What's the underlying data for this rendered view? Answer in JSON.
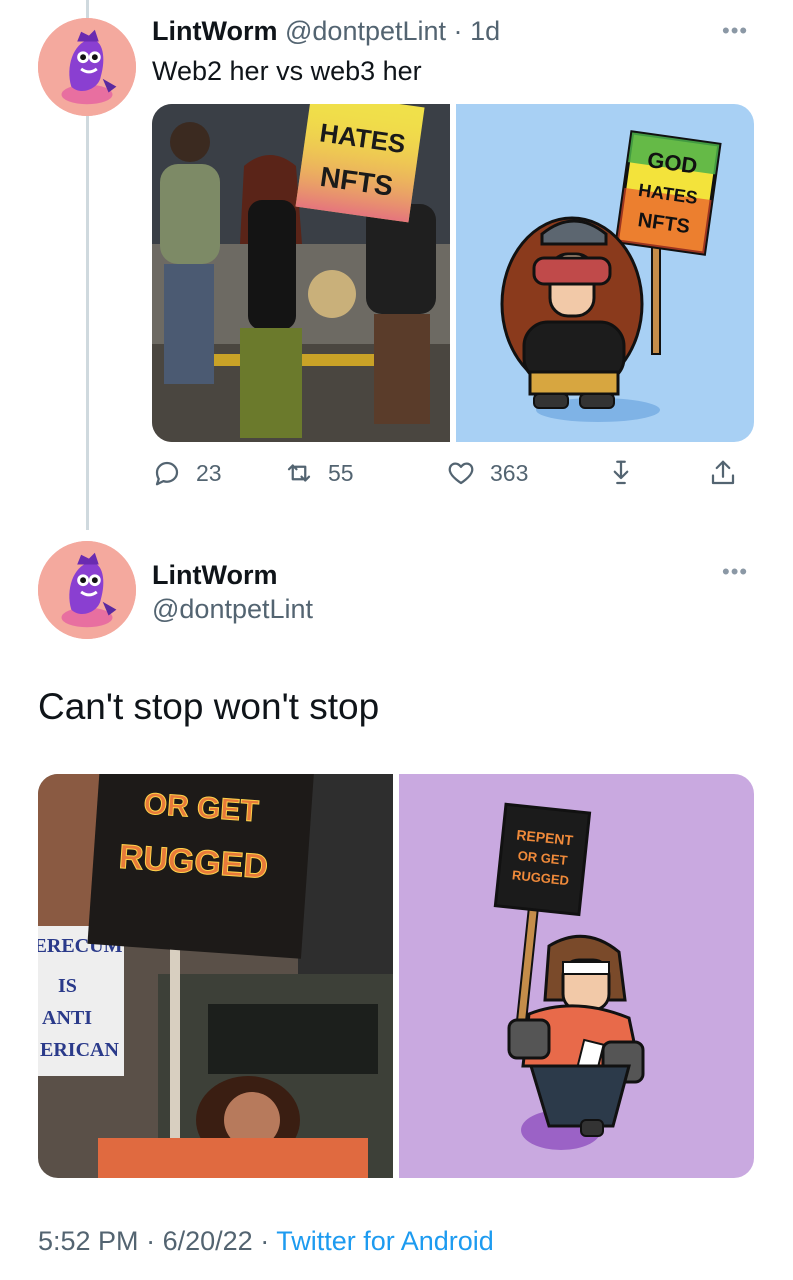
{
  "tweet1": {
    "author_name": "LintWorm",
    "author_handle": "@dontpetLint",
    "separator": "·",
    "time_ago": "1d",
    "text": "Web2 her vs web3 her",
    "photo_left_sign": [
      "HATES",
      "NFTS"
    ],
    "photo_right_sign": [
      "GOD",
      "HATES",
      "NFTS"
    ],
    "actions": {
      "replies": "23",
      "retweets": "55",
      "likes": "363"
    }
  },
  "tweet2": {
    "author_name": "LintWorm",
    "author_handle": "@dontpetLint",
    "text": "Can't stop won't stop",
    "photo_left_sign": [
      "OR GET",
      "RUGGED"
    ],
    "photo_left_side_sign": [
      "ERECUM",
      "IS",
      "ANTI",
      "ERICAN"
    ],
    "photo_right_sign": [
      "REPENT",
      "OR GET",
      "RUGGED"
    ],
    "time": "5:52 PM",
    "date": "6/20/22",
    "separator": "·",
    "source": "Twitter for Android"
  },
  "icons": {
    "more": "more-horizontal-icon",
    "reply": "reply-icon",
    "retweet": "retweet-icon",
    "like": "heart-icon",
    "download": "download-icon",
    "share": "share-icon"
  },
  "colors": {
    "link": "#1d9bf0",
    "secondary_text": "#536471",
    "avatar_bg": "#f4a99e",
    "right_photo1_bg": "#a8d0f4",
    "right_photo2_bg": "#c9a9e0"
  }
}
